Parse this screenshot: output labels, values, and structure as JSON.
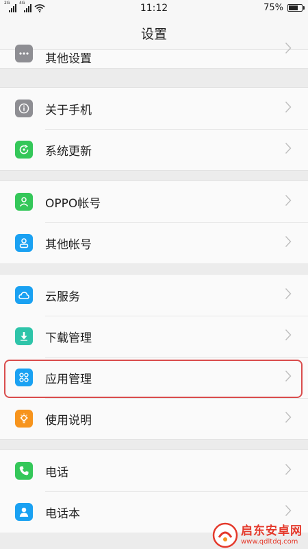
{
  "status_bar": {
    "sim1_network": "2G",
    "sim2_network": "4G",
    "time": "11:12",
    "battery_percent_text": "75%",
    "battery_level": 0.75
  },
  "header": {
    "title": "设置"
  },
  "groups": [
    {
      "items": [
        {
          "label": "其他设置",
          "icon": "more-dots-icon",
          "color": "#8e8e93"
        }
      ]
    },
    {
      "items": [
        {
          "label": "关于手机",
          "icon": "info-icon",
          "color": "#8e8e93"
        },
        {
          "label": "系统更新",
          "icon": "system-update-icon",
          "color": "#34c759"
        }
      ]
    },
    {
      "items": [
        {
          "label": "OPPO帐号",
          "icon": "oppo-account-icon",
          "color": "#34c759"
        },
        {
          "label": "其他帐号",
          "icon": "other-account-icon",
          "color": "#1aa1f2"
        }
      ]
    },
    {
      "items": [
        {
          "label": "云服务",
          "icon": "cloud-icon",
          "color": "#1aa1f2"
        },
        {
          "label": "下载管理",
          "icon": "download-icon",
          "color": "#2ec4a9"
        },
        {
          "label": "应用管理",
          "icon": "apps-icon",
          "color": "#1aa1f2"
        },
        {
          "label": "使用说明",
          "icon": "lightbulb-icon",
          "color": "#f7941d"
        }
      ]
    },
    {
      "items": [
        {
          "label": "电话",
          "icon": "phone-icon",
          "color": "#34c759"
        },
        {
          "label": "电话本",
          "icon": "contacts-icon",
          "color": "#1aa1f2"
        }
      ]
    }
  ],
  "colors": {
    "highlight_border": "#d94c4c",
    "watermark_red": "#e4392b"
  },
  "watermark": {
    "main": "启东安卓网",
    "sub": "www.qdltdq.com"
  }
}
